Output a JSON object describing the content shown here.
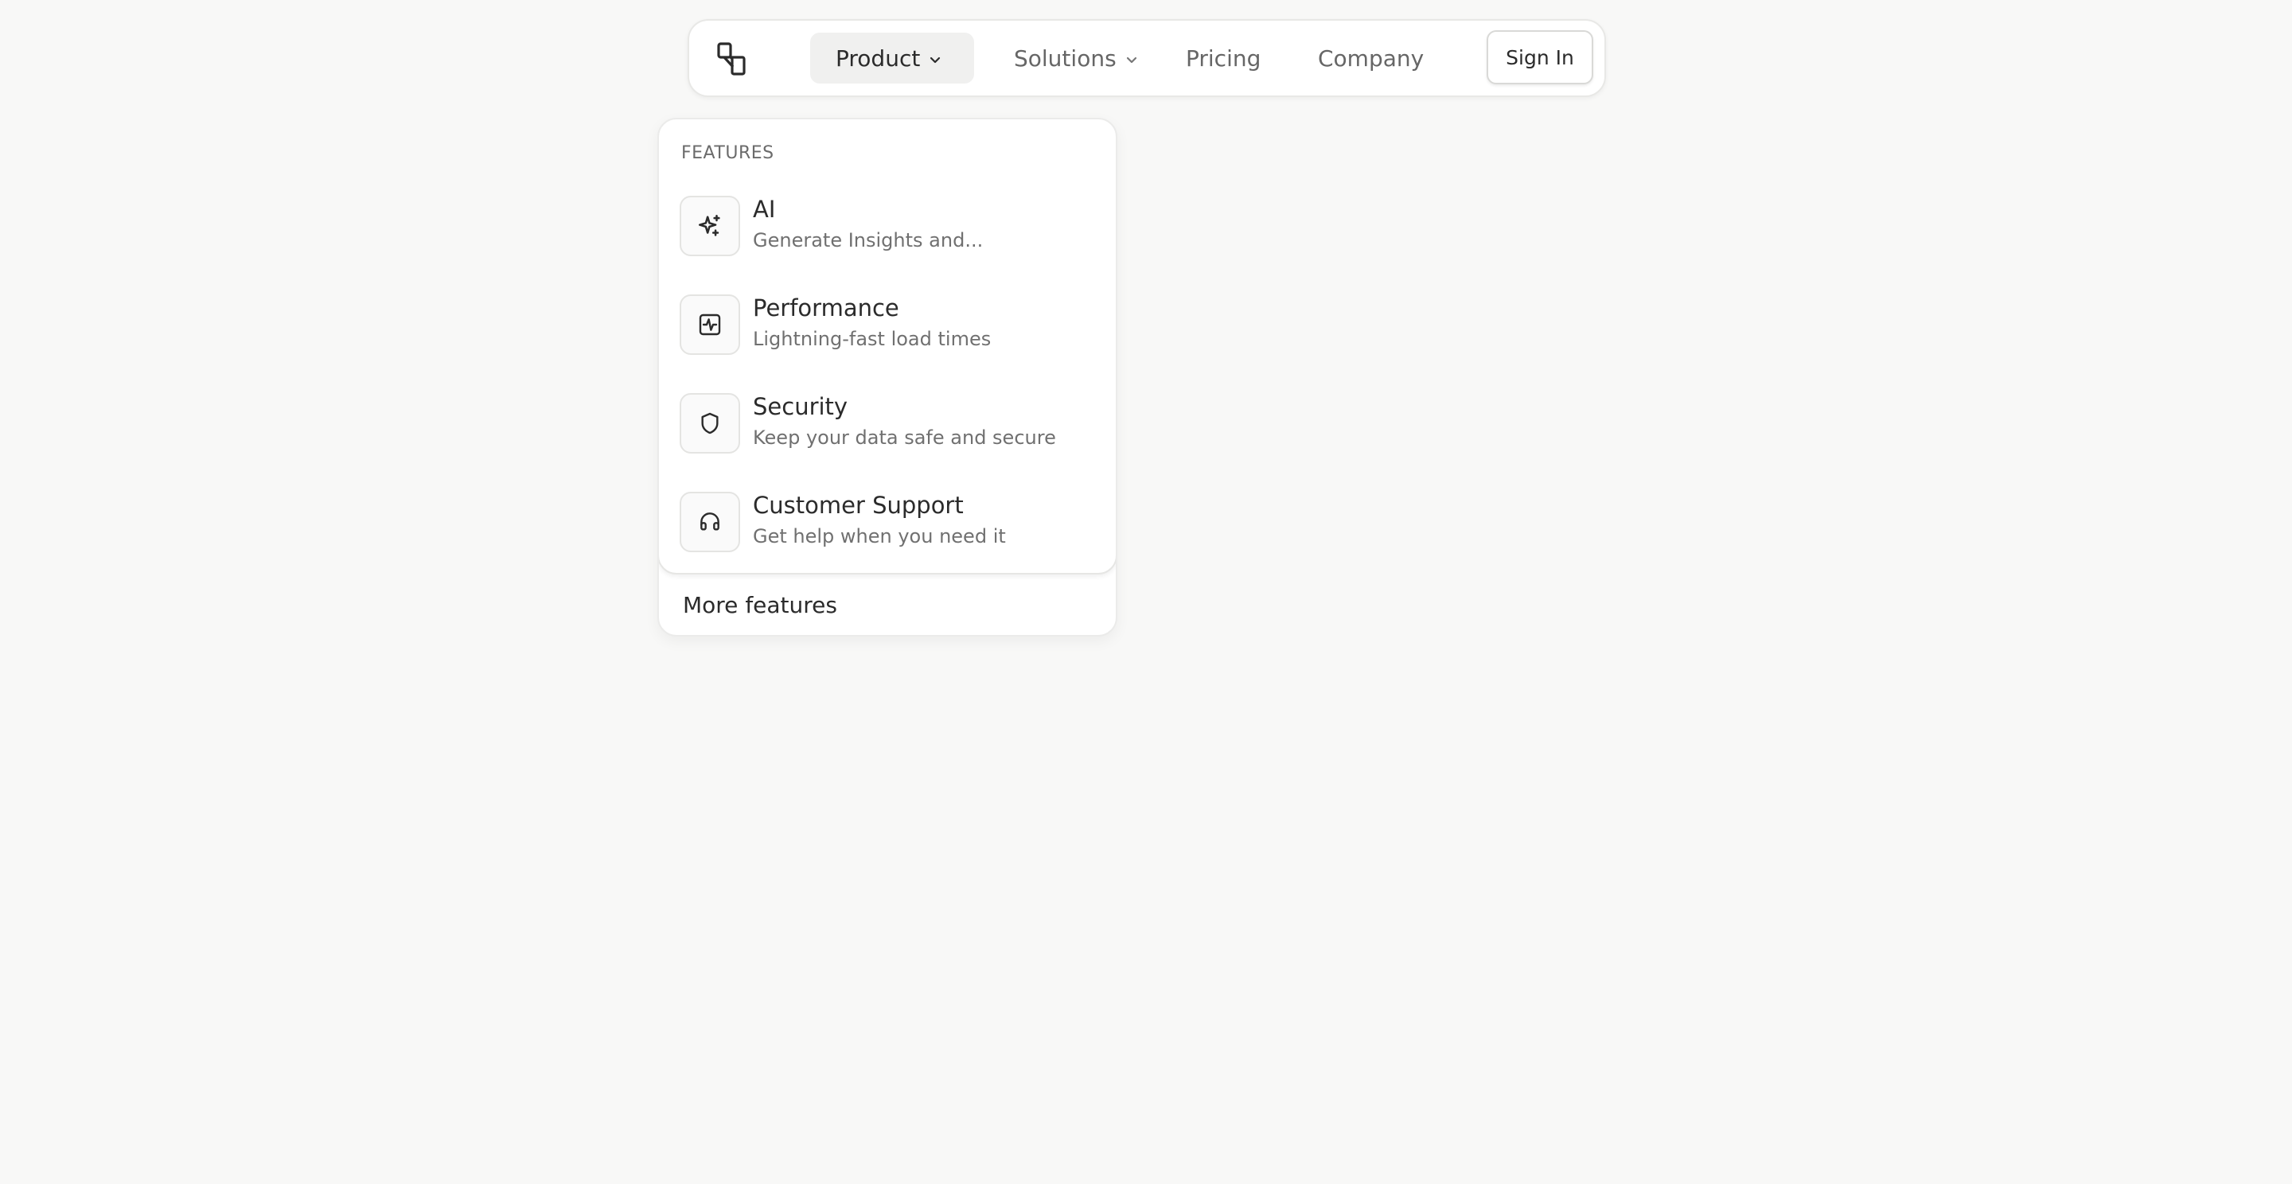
{
  "nav": {
    "logo_icon": "logo-icon",
    "items": [
      {
        "label": "Product",
        "has_dropdown": true,
        "active": true
      },
      {
        "label": "Solutions",
        "has_dropdown": true,
        "active": false
      },
      {
        "label": "Pricing",
        "has_dropdown": false,
        "active": false
      },
      {
        "label": "Company",
        "has_dropdown": false,
        "active": false
      }
    ],
    "signin_label": "Sign In"
  },
  "dropdown": {
    "section_label": "FEATURES",
    "features": [
      {
        "title": "AI",
        "description": "Generate Insights and...",
        "icon": "sparkles-icon"
      },
      {
        "title": "Performance",
        "description": "Lightning-fast load times",
        "icon": "activity-square-icon"
      },
      {
        "title": "Security",
        "description": "Keep your data safe and secure",
        "icon": "shield-icon"
      },
      {
        "title": "Customer Support",
        "description": "Get help when you need it",
        "icon": "headphones-icon"
      }
    ],
    "more_label": "More features"
  },
  "colors": {
    "background": "#f8f8f7",
    "active_nav_bg": "#f0f0ef",
    "text_primary": "#2b2b2b",
    "text_secondary": "#707070"
  }
}
